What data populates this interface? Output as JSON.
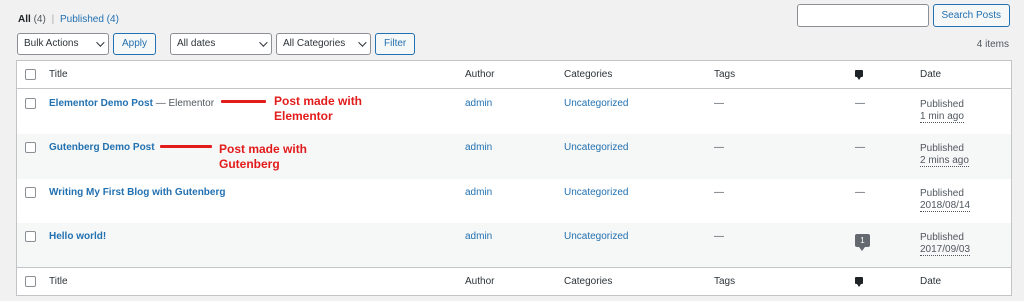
{
  "views": {
    "all_label": "All",
    "all_count": "(4)",
    "separator": "|",
    "published_label": "Published",
    "published_count": "(4)"
  },
  "search": {
    "value": "",
    "placeholder": "",
    "button": "Search Posts"
  },
  "filters": {
    "bulk_actions": "Bulk Actions",
    "apply": "Apply",
    "dates": "All dates",
    "categories": "All Categories",
    "filter": "Filter"
  },
  "items_count": "4 items",
  "columns": {
    "title": "Title",
    "author": "Author",
    "categories": "Categories",
    "tags": "Tags",
    "comments_icon": "comment-bubble-icon",
    "date": "Date"
  },
  "posts": [
    {
      "title": "Elementor Demo Post",
      "state": " — Elementor",
      "author": "admin",
      "category": "Uncategorized",
      "tags": "—",
      "comments": "—",
      "status": "Published",
      "date": "1 min ago"
    },
    {
      "title": "Gutenberg Demo Post",
      "state": "",
      "author": "admin",
      "category": "Uncategorized",
      "tags": "—",
      "comments": "—",
      "status": "Published",
      "date": "2 mins ago"
    },
    {
      "title": "Writing My First Blog with Gutenberg",
      "state": "",
      "author": "admin",
      "category": "Uncategorized",
      "tags": "—",
      "comments": "—",
      "status": "Published",
      "date": "2018/08/14"
    },
    {
      "title": "Hello world!",
      "state": "",
      "author": "admin",
      "category": "Uncategorized",
      "tags": "—",
      "comments": "1",
      "status": "Published",
      "date": "2017/09/03"
    }
  ],
  "annotations": {
    "elementor_line1": "Post made with",
    "elementor_line2": "Elementor",
    "gutenberg_line1": "Post made with",
    "gutenberg_line2": "Gutenberg",
    "color": "#e21b1b"
  }
}
